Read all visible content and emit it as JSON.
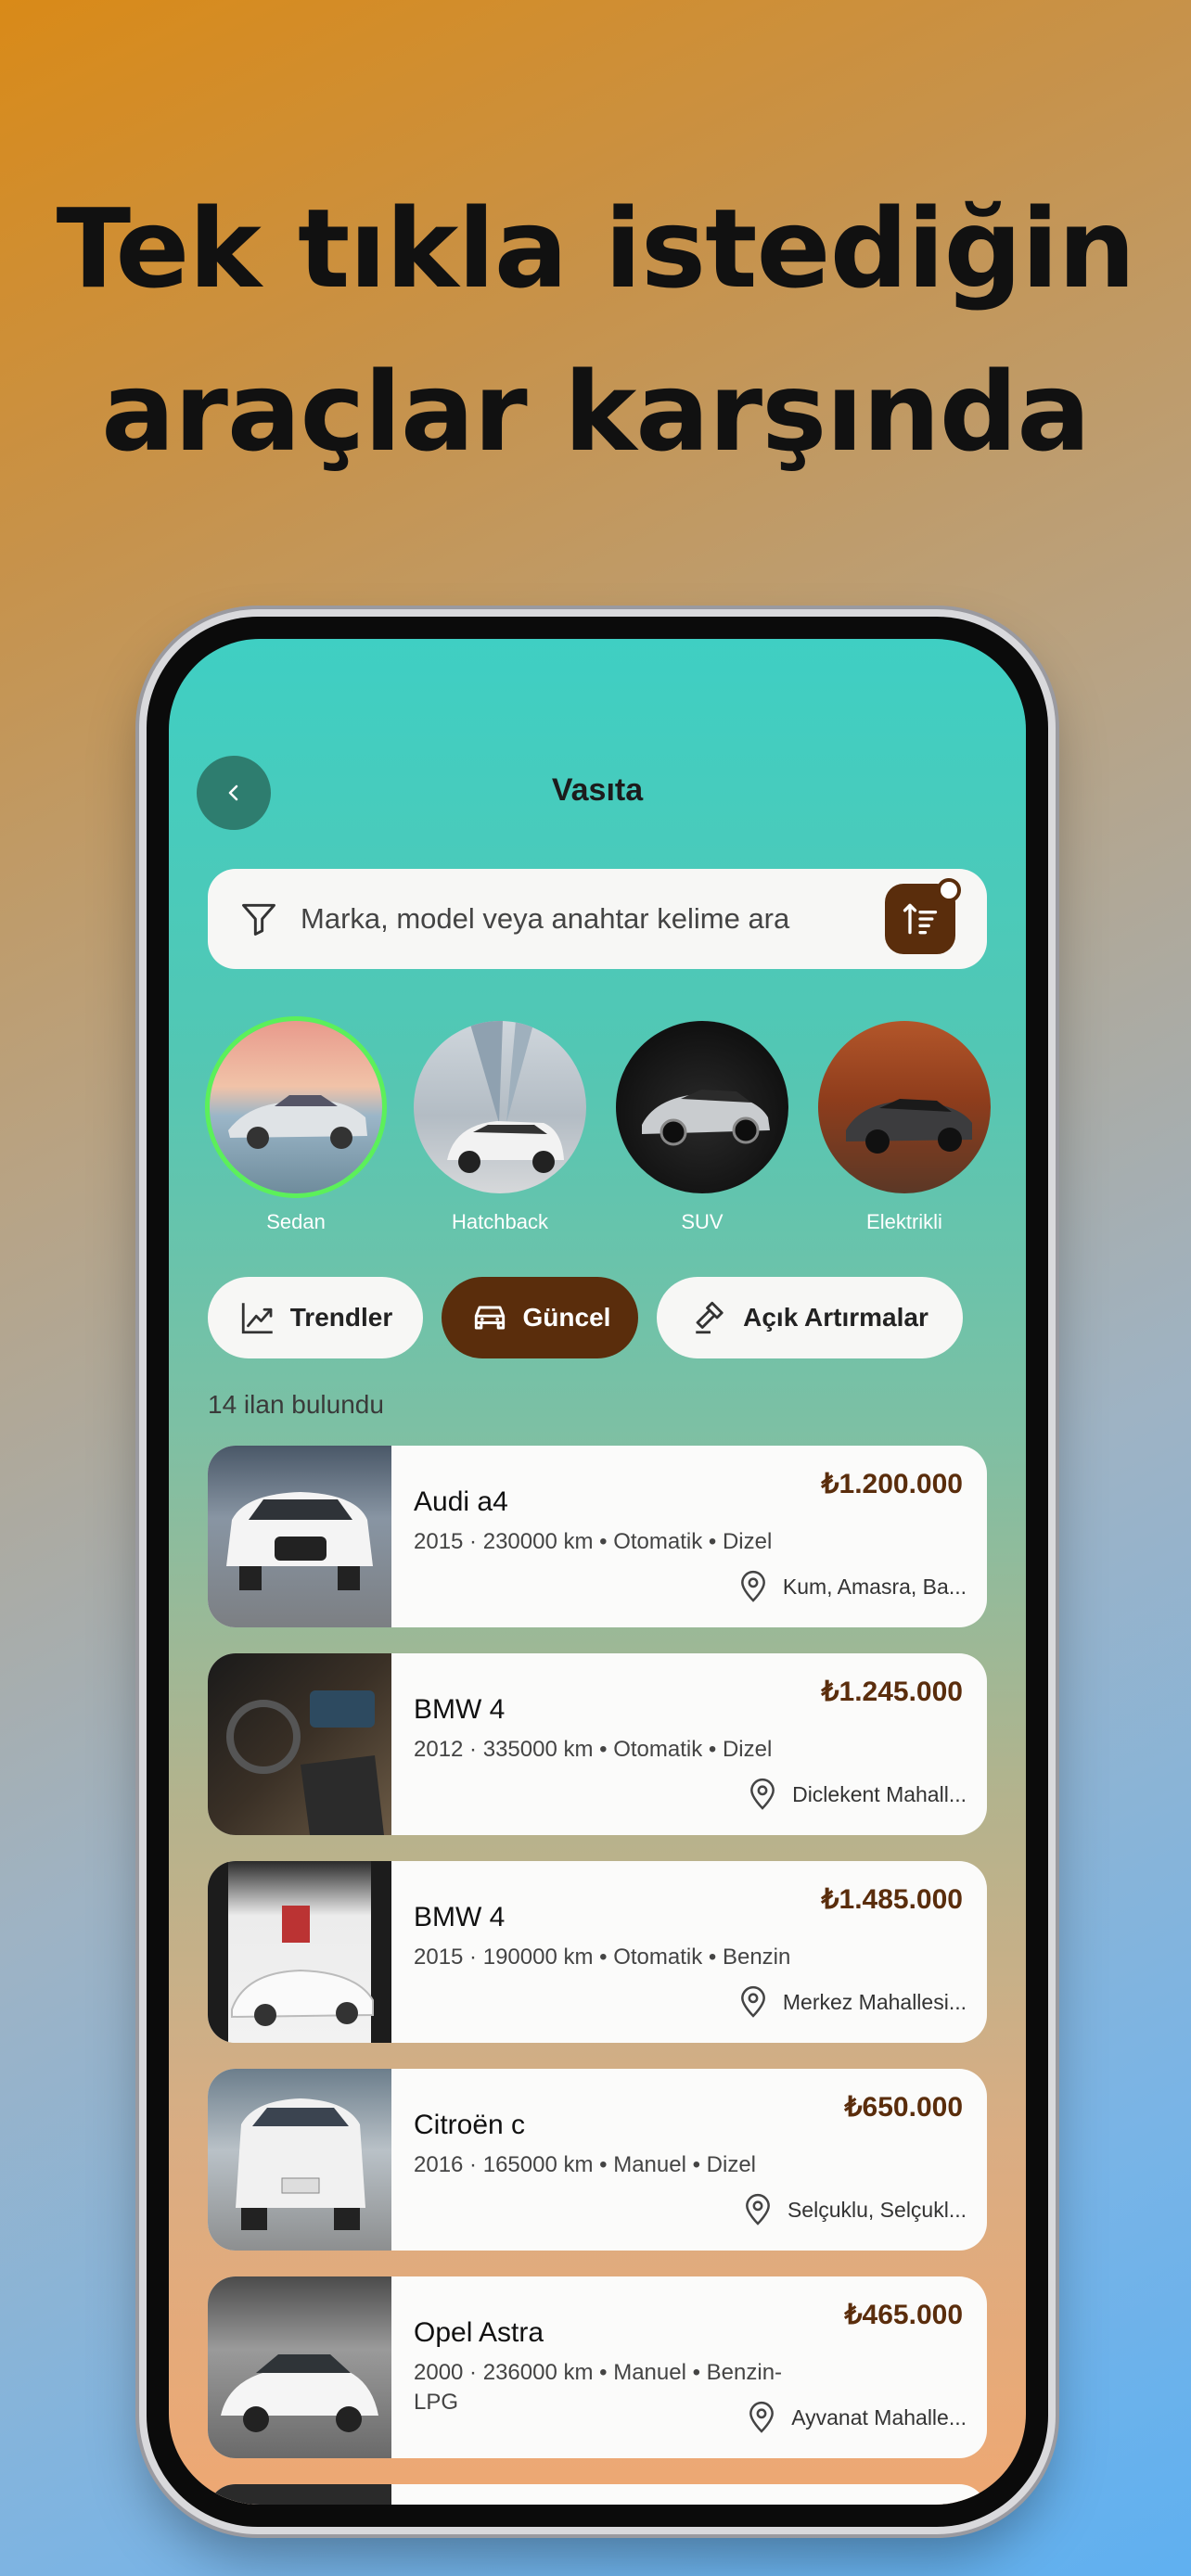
{
  "headline": {
    "line1": "Tek tıkla istediğin",
    "line2": "araçlar karşında"
  },
  "topbar": {
    "title": "Vasıta",
    "back_icon": "chevron-left-icon"
  },
  "search": {
    "placeholder": "Marka, model veya anahtar kelime ara",
    "filter_icon": "filter-icon",
    "sort_icon": "sort-icon"
  },
  "categories": [
    {
      "label": "Sedan",
      "selected": true
    },
    {
      "label": "Hatchback",
      "selected": false
    },
    {
      "label": "SUV",
      "selected": false
    },
    {
      "label": "Elektrikli",
      "selected": false
    }
  ],
  "chips": [
    {
      "label": "Trendler",
      "icon": "trend-icon",
      "active": false
    },
    {
      "label": "Güncel",
      "icon": "car-icon",
      "active": true
    },
    {
      "label": "Açık Artırmalar",
      "icon": "gavel-icon",
      "active": false
    }
  ],
  "results": {
    "count_text": "14 ilan bulundu"
  },
  "listings": [
    {
      "name": "Audi a4",
      "price": "₺1.200.000",
      "meta": "2015 · 230000 km • Otomatik • Dizel",
      "location": "Kum, Amasra, Ba..."
    },
    {
      "name": "BMW 4",
      "price": "₺1.245.000",
      "meta": "2012 · 335000 km • Otomatik • Dizel",
      "location": "Diclekent Mahall..."
    },
    {
      "name": "BMW 4",
      "price": "₺1.485.000",
      "meta": "2015 · 190000 km • Otomatik • Benzin",
      "location": "Merkez Mahallesi..."
    },
    {
      "name": "Citroën c",
      "price": "₺650.000",
      "meta": "2016 · 165000 km • Manuel • Dizel",
      "location": "Selçuklu, Selçukl..."
    },
    {
      "name": "Opel Astra",
      "price": "₺465.000",
      "meta": "2000 · 236000 km • Manuel • Benzin-LPG",
      "location": "Ayvanat Mahalle..."
    }
  ],
  "colors": {
    "accent": "#5a2d0c",
    "selected_ring": "#5cf05a",
    "back_button": "#2e7d6f"
  }
}
